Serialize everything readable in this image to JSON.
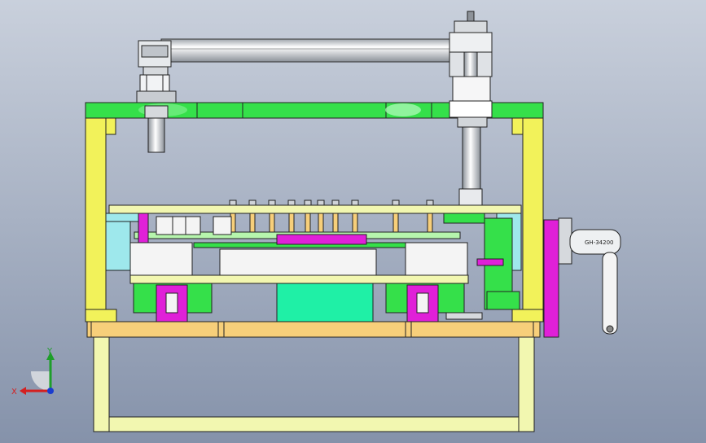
{
  "viewport": {
    "background_top": "#c9d0dc",
    "background_bottom": "#8592aa"
  },
  "triad": {
    "y_label": "Y",
    "x_label": "X",
    "y_color": "#1e9e2a",
    "x_color": "#d42020",
    "z_color": "#1a3ccf"
  },
  "clamp_tag": {
    "text": "GH-34200"
  },
  "colors": {
    "green_plate": "#35e04a",
    "yellow_frame": "#f2f25a",
    "orange_base": "#f7cf7a",
    "light_yellow": "#f2f7b0",
    "cyan_bracket": "#9ee8ec",
    "magenta": "#e020d8",
    "teal_block": "#1ff0a6",
    "steel": "#cfd3d8",
    "white_block": "#f4f4f4"
  }
}
